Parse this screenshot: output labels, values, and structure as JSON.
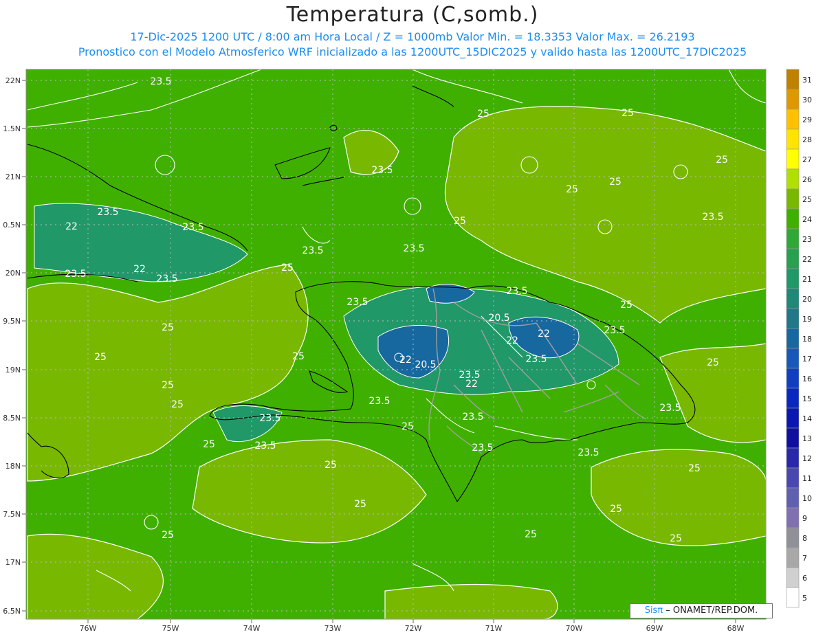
{
  "header": {
    "title": "Temperatura (C,somb.)",
    "subtitle_line1": "17-Dic-2025  1200 UTC / 8:00 am Hora Local / Z = 1000mb    Valor Min. = 18.3353  Valor Max. = 26.2193",
    "subtitle_line2": "Pronostico con el Modelo Atmosferico WRF inicializado a las 1200UTC_15DIC2025 y valido hasta las  1200UTC_17DIC2025"
  },
  "axes": {
    "lat_labels": [
      "22N",
      "1.5N",
      "21N",
      "0.5N",
      "20N",
      "9.5N",
      "19N",
      "8.5N",
      "18N",
      "7.5N",
      "17N",
      "6.5N"
    ],
    "lon_labels": [
      "76W",
      "75W",
      "74W",
      "73W",
      "72W",
      "71W",
      "70W",
      "69W",
      "68W"
    ]
  },
  "colorbar": {
    "labels": [
      "31",
      "30",
      "29",
      "28",
      "27",
      "26",
      "25",
      "24",
      "23",
      "22",
      "21",
      "20",
      "19",
      "18",
      "17",
      "16",
      "15",
      "14",
      "13",
      "12",
      "11",
      "10",
      "9",
      "8",
      "7",
      "6",
      "5"
    ],
    "colors": [
      "#c08000",
      "#e09800",
      "#ffc000",
      "#ffe400",
      "#ffff00",
      "#b0e000",
      "#78b800",
      "#40b000",
      "#30a838",
      "#28a050",
      "#209868",
      "#208878",
      "#207888",
      "#1868a0",
      "#1858b8",
      "#1040c0",
      "#0828c0",
      "#0818b0",
      "#1010a0",
      "#2828a8",
      "#4848b0",
      "#6060b0",
      "#8070b0",
      "#909098",
      "#a8a8a8",
      "#d0d0d0",
      "#ffffff"
    ]
  },
  "contour_labels": [
    "23.5",
    "25",
    "25",
    "23.5",
    "25",
    "25",
    "25",
    "22",
    "23.5",
    "23.5",
    "22",
    "23.5",
    "23.5",
    "23.5",
    "25",
    "23.5",
    "25",
    "23.5",
    "23.5",
    "20.5",
    "23.5",
    "25",
    "25",
    "22",
    "22",
    "23.5",
    "23.5",
    "23.5",
    "22",
    "20.5",
    "25",
    "25",
    "25",
    "22",
    "23.5",
    "23.5",
    "25",
    "23.5",
    "25",
    "23.5",
    "23.5",
    "25",
    "25",
    "23.5",
    "23.5",
    "25",
    "25",
    "25",
    "25",
    "25",
    "25",
    "25"
  ],
  "credit": {
    "brand": "Sisπ",
    "text": " – ONAMET/REP.DOM."
  },
  "colors": {
    "ocean": "#40b000",
    "land_warm": "#78b800",
    "cool": "#209868",
    "coolest": "#1868a0",
    "coastline": "#000000",
    "borders": "#a0a0a0",
    "contours": "#ffffff"
  }
}
